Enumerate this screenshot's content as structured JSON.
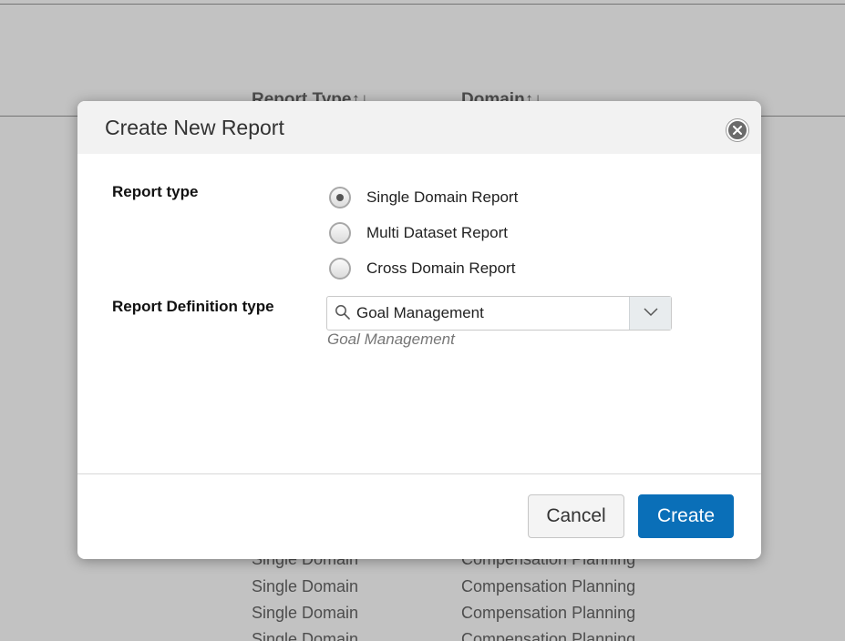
{
  "background": {
    "columns": [
      "Report Type",
      "Domain"
    ],
    "sort_icon": "sort-arrows-icon",
    "rows": [
      {
        "type": "Single Domain",
        "domain": "Compensation Planning"
      },
      {
        "type": "Single Domain",
        "domain": "Compensation Planning"
      },
      {
        "type": "Single Domain",
        "domain": "Compensation Planning"
      },
      {
        "type": "Single Domain",
        "domain": "Compensation Planning"
      }
    ]
  },
  "dialog": {
    "title": "Create New Report",
    "close_icon": "close-icon",
    "report_type": {
      "label": "Report type",
      "options": [
        {
          "label": "Single Domain Report",
          "checked": true
        },
        {
          "label": "Multi Dataset Report",
          "checked": false
        },
        {
          "label": "Cross Domain Report",
          "checked": false
        }
      ]
    },
    "definition_type": {
      "label": "Report Definition type",
      "value": "Goal Management",
      "hint": "Goal Management",
      "search_icon": "search-icon",
      "dropdown_icon": "chevron-down-icon"
    },
    "buttons": {
      "cancel": "Cancel",
      "create": "Create"
    },
    "colors": {
      "primary": "#0a6fb8",
      "header_bg": "#f2f2f2"
    }
  }
}
